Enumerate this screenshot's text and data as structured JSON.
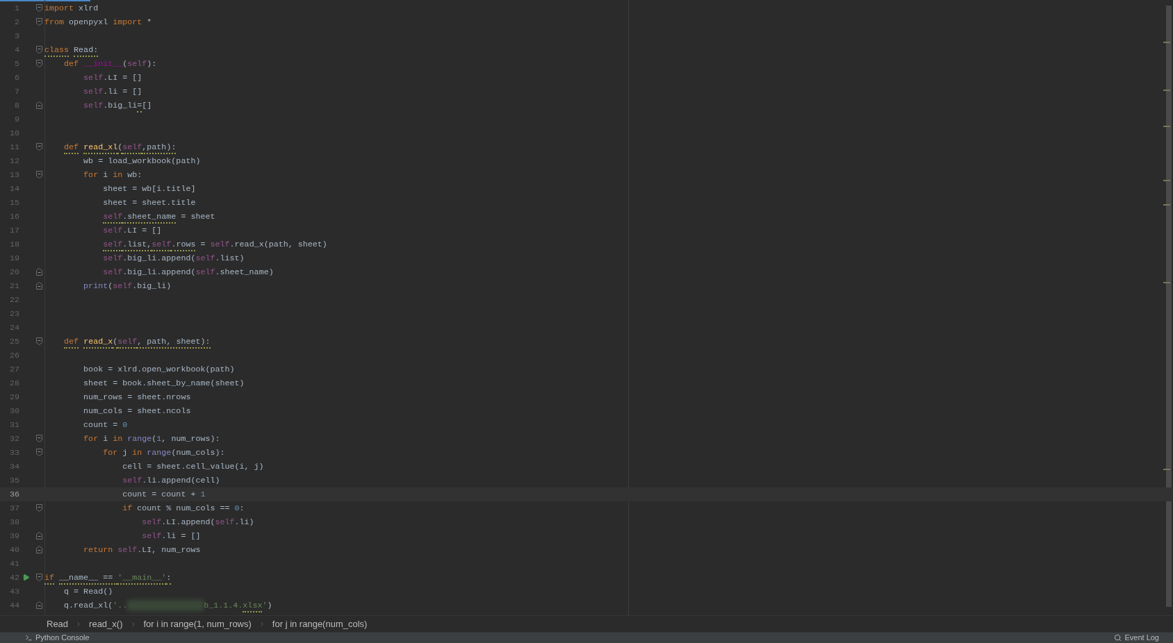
{
  "editor": {
    "lines": [
      {
        "number": "1",
        "fold_open": true,
        "fold_close": false,
        "run": false,
        "selected": false,
        "tokens": [
          {
            "text": "import",
            "kind": "keyword",
            "underlined": false
          },
          {
            "text": " xlrd",
            "kind": "plain",
            "underlined": false
          }
        ]
      },
      {
        "number": "2",
        "fold_open": true,
        "fold_close": false,
        "run": false,
        "selected": false,
        "tokens": [
          {
            "text": "from",
            "kind": "keyword",
            "underlined": false
          },
          {
            "text": " openpyxl ",
            "kind": "plain",
            "underlined": false
          },
          {
            "text": "import",
            "kind": "keyword",
            "underlined": false
          },
          {
            "text": " *",
            "kind": "plain",
            "underlined": false
          }
        ]
      },
      {
        "number": "3",
        "fold_open": false,
        "fold_close": false,
        "run": false,
        "selected": false
      },
      {
        "number": "4",
        "fold_open": true,
        "fold_close": false,
        "run": false,
        "selected": false,
        "tokens": [
          {
            "text": "class",
            "kind": "keyword",
            "underlined": true
          },
          {
            "text": " Read:",
            "kind": "plain",
            "underlined": true
          }
        ]
      },
      {
        "number": "5",
        "fold_open": true,
        "fold_close": false,
        "run": false,
        "selected": false,
        "tokens": [
          {
            "text": "    def",
            "kind": "keyword",
            "underlined": false
          },
          {
            "text": " __init__",
            "kind": "dunder",
            "underlined": false
          },
          {
            "text": "(",
            "kind": "plain",
            "underlined": false
          },
          {
            "text": "self",
            "kind": "self",
            "underlined": false
          },
          {
            "text": "):",
            "kind": "plain",
            "underlined": false
          }
        ]
      },
      {
        "number": "6",
        "fold_open": false,
        "fold_close": false,
        "run": false,
        "selected": false,
        "tokens": [
          {
            "text": "        self",
            "kind": "self",
            "underlined": false
          },
          {
            "text": ".LI = []",
            "kind": "plain",
            "underlined": false
          }
        ]
      },
      {
        "number": "7",
        "fold_open": false,
        "fold_close": false,
        "run": false,
        "selected": false,
        "tokens": [
          {
            "text": "        self",
            "kind": "self",
            "underlined": false
          },
          {
            "text": ".li = []",
            "kind": "plain",
            "underlined": false
          }
        ]
      },
      {
        "number": "8",
        "fold_open": false,
        "fold_close": true,
        "run": false,
        "selected": false,
        "tokens": [
          {
            "text": "        self",
            "kind": "self",
            "underlined": false
          },
          {
            "text": ".big_li",
            "kind": "plain",
            "underlined": false
          },
          {
            "text": "=",
            "kind": "plain",
            "underlined": true
          },
          {
            "text": "[]",
            "kind": "plain",
            "underlined": false
          }
        ]
      },
      {
        "number": "9",
        "fold_open": false,
        "fold_close": false,
        "run": false,
        "selected": false
      },
      {
        "number": "10",
        "fold_open": false,
        "fold_close": false,
        "run": false,
        "selected": false
      },
      {
        "number": "11",
        "fold_open": true,
        "fold_close": false,
        "run": false,
        "selected": false,
        "tokens": [
          {
            "text": "    def",
            "kind": "keyword",
            "underlined": true
          },
          {
            "text": " read_xl",
            "kind": "funcdef",
            "underlined": true
          },
          {
            "text": "(",
            "kind": "plain",
            "underlined": true
          },
          {
            "text": "self",
            "kind": "self",
            "underlined": true
          },
          {
            "text": ",path):",
            "kind": "plain",
            "underlined": true
          }
        ]
      },
      {
        "number": "12",
        "fold_open": false,
        "fold_close": false,
        "run": false,
        "selected": false,
        "tokens": [
          {
            "text": "        wb = load_workbook(path)",
            "kind": "plain",
            "underlined": false
          }
        ]
      },
      {
        "number": "13",
        "fold_open": true,
        "fold_close": false,
        "run": false,
        "selected": false,
        "tokens": [
          {
            "text": "        for",
            "kind": "keyword",
            "underlined": false
          },
          {
            "text": " i ",
            "kind": "plain",
            "underlined": false
          },
          {
            "text": "in",
            "kind": "keyword",
            "underlined": false
          },
          {
            "text": " wb:",
            "kind": "plain",
            "underlined": false
          }
        ]
      },
      {
        "number": "14",
        "fold_open": false,
        "fold_close": false,
        "run": false,
        "selected": false,
        "tokens": [
          {
            "text": "            sheet = wb[i.title]",
            "kind": "plain",
            "underlined": false
          }
        ]
      },
      {
        "number": "15",
        "fold_open": false,
        "fold_close": false,
        "run": false,
        "selected": false,
        "tokens": [
          {
            "text": "            sheet = sheet.title",
            "kind": "plain",
            "underlined": false
          }
        ]
      },
      {
        "number": "16",
        "fold_open": false,
        "fold_close": false,
        "run": false,
        "selected": false,
        "tokens": [
          {
            "text": "            self",
            "kind": "self",
            "underlined": true
          },
          {
            "text": ".sheet_name",
            "kind": "plain",
            "underlined": true
          },
          {
            "text": " = sheet",
            "kind": "plain",
            "underlined": false
          }
        ]
      },
      {
        "number": "17",
        "fold_open": false,
        "fold_close": false,
        "run": false,
        "selected": false,
        "tokens": [
          {
            "text": "            self",
            "kind": "self",
            "underlined": false
          },
          {
            "text": ".LI = []",
            "kind": "plain",
            "underlined": false
          }
        ]
      },
      {
        "number": "18",
        "fold_open": false,
        "fold_close": false,
        "run": false,
        "selected": false,
        "tokens": [
          {
            "text": "            self",
            "kind": "self",
            "underlined": true
          },
          {
            "text": ".list,",
            "kind": "plain",
            "underlined": true
          },
          {
            "text": "self",
            "kind": "self",
            "underlined": true
          },
          {
            "text": ".rows",
            "kind": "plain",
            "underlined": true
          },
          {
            "text": " = ",
            "kind": "plain",
            "underlined": false
          },
          {
            "text": "self",
            "kind": "self",
            "underlined": false
          },
          {
            "text": ".read_x(path, sheet)",
            "kind": "plain",
            "underlined": false
          }
        ]
      },
      {
        "number": "19",
        "fold_open": false,
        "fold_close": false,
        "run": false,
        "selected": false,
        "tokens": [
          {
            "text": "            self",
            "kind": "self",
            "underlined": false
          },
          {
            "text": ".big_li.append(",
            "kind": "plain",
            "underlined": false
          },
          {
            "text": "self",
            "kind": "self",
            "underlined": false
          },
          {
            "text": ".list)",
            "kind": "plain",
            "underlined": false
          }
        ]
      },
      {
        "number": "20",
        "fold_open": false,
        "fold_close": true,
        "run": false,
        "selected": false,
        "tokens": [
          {
            "text": "            self",
            "kind": "self",
            "underlined": false
          },
          {
            "text": ".big_li.append(",
            "kind": "plain",
            "underlined": false
          },
          {
            "text": "self",
            "kind": "self",
            "underlined": false
          },
          {
            "text": ".sheet_name)",
            "kind": "plain",
            "underlined": false
          }
        ]
      },
      {
        "number": "21",
        "fold_open": false,
        "fold_close": true,
        "run": false,
        "selected": false,
        "tokens": [
          {
            "text": "        print",
            "kind": "builtin",
            "underlined": false
          },
          {
            "text": "(",
            "kind": "plain",
            "underlined": false
          },
          {
            "text": "self",
            "kind": "self",
            "underlined": false
          },
          {
            "text": ".big_li)",
            "kind": "plain",
            "underlined": false
          }
        ]
      },
      {
        "number": "22",
        "fold_open": false,
        "fold_close": false,
        "run": false,
        "selected": false
      },
      {
        "number": "23",
        "fold_open": false,
        "fold_close": false,
        "run": false,
        "selected": false
      },
      {
        "number": "24",
        "fold_open": false,
        "fold_close": false,
        "run": false,
        "selected": false
      },
      {
        "number": "25",
        "fold_open": true,
        "fold_close": false,
        "run": false,
        "selected": false,
        "tokens": [
          {
            "text": "    def",
            "kind": "keyword",
            "underlined": true
          },
          {
            "text": " read_x",
            "kind": "funcdef",
            "underlined": true
          },
          {
            "text": "(",
            "kind": "plain",
            "underlined": true
          },
          {
            "text": "self",
            "kind": "self",
            "underlined": true
          },
          {
            "text": ", path, sheet):",
            "kind": "plain",
            "underlined": true
          }
        ]
      },
      {
        "number": "26",
        "fold_open": false,
        "fold_close": false,
        "run": false,
        "selected": false
      },
      {
        "number": "27",
        "fold_open": false,
        "fold_close": false,
        "run": false,
        "selected": false,
        "tokens": [
          {
            "text": "        book = xlrd.open_workbook(path)",
            "kind": "plain",
            "underlined": false
          }
        ]
      },
      {
        "number": "28",
        "fold_open": false,
        "fold_close": false,
        "run": false,
        "selected": false,
        "tokens": [
          {
            "text": "        sheet = book.sheet_by_name(sheet)",
            "kind": "plain",
            "underlined": false
          }
        ]
      },
      {
        "number": "29",
        "fold_open": false,
        "fold_close": false,
        "run": false,
        "selected": false,
        "tokens": [
          {
            "text": "        num_rows = sheet.nrows",
            "kind": "plain",
            "underlined": false
          }
        ]
      },
      {
        "number": "30",
        "fold_open": false,
        "fold_close": false,
        "run": false,
        "selected": false,
        "tokens": [
          {
            "text": "        num_cols = sheet.ncols",
            "kind": "plain",
            "underlined": false
          }
        ]
      },
      {
        "number": "31",
        "fold_open": false,
        "fold_close": false,
        "run": false,
        "selected": false,
        "tokens": [
          {
            "text": "        count = ",
            "kind": "plain",
            "underlined": false
          },
          {
            "text": "0",
            "kind": "number",
            "underlined": false
          }
        ]
      },
      {
        "number": "32",
        "fold_open": true,
        "fold_close": false,
        "run": false,
        "selected": false,
        "tokens": [
          {
            "text": "        for",
            "kind": "keyword",
            "underlined": false
          },
          {
            "text": " i ",
            "kind": "plain",
            "underlined": false
          },
          {
            "text": "in",
            "kind": "keyword",
            "underlined": false
          },
          {
            "text": " range",
            "kind": "builtin",
            "underlined": false
          },
          {
            "text": "(",
            "kind": "plain",
            "underlined": false
          },
          {
            "text": "1",
            "kind": "number",
            "underlined": false
          },
          {
            "text": ", num_rows):",
            "kind": "plain",
            "underlined": false
          }
        ]
      },
      {
        "number": "33",
        "fold_open": true,
        "fold_close": false,
        "run": false,
        "selected": false,
        "tokens": [
          {
            "text": "            for",
            "kind": "keyword",
            "underlined": false
          },
          {
            "text": " j ",
            "kind": "plain",
            "underlined": false
          },
          {
            "text": "in",
            "kind": "keyword",
            "underlined": false
          },
          {
            "text": " range",
            "kind": "builtin",
            "underlined": false
          },
          {
            "text": "(num_cols):",
            "kind": "plain",
            "underlined": false
          }
        ]
      },
      {
        "number": "34",
        "fold_open": false,
        "fold_close": false,
        "run": false,
        "selected": false,
        "tokens": [
          {
            "text": "                cell = sheet.cell_value(i, j)",
            "kind": "plain",
            "underlined": false
          }
        ]
      },
      {
        "number": "35",
        "fold_open": false,
        "fold_close": false,
        "run": false,
        "selected": false,
        "tokens": [
          {
            "text": "                self",
            "kind": "self",
            "underlined": false
          },
          {
            "text": ".li.append(cell)",
            "kind": "plain",
            "underlined": false
          }
        ]
      },
      {
        "number": "36",
        "fold_open": false,
        "fold_close": false,
        "run": false,
        "selected": true,
        "tokens": [
          {
            "text": "                count = count + ",
            "kind": "plain",
            "underlined": false
          },
          {
            "text": "1",
            "kind": "number",
            "underlined": false
          }
        ]
      },
      {
        "number": "37",
        "fold_open": true,
        "fold_close": false,
        "run": false,
        "selected": false,
        "tokens": [
          {
            "text": "                if",
            "kind": "keyword",
            "underlined": false
          },
          {
            "text": " count % num_cols == ",
            "kind": "plain",
            "underlined": false
          },
          {
            "text": "0",
            "kind": "number",
            "underlined": false
          },
          {
            "text": ":",
            "kind": "plain",
            "underlined": false
          }
        ]
      },
      {
        "number": "38",
        "fold_open": false,
        "fold_close": false,
        "run": false,
        "selected": false,
        "tokens": [
          {
            "text": "                    self",
            "kind": "self",
            "underlined": false
          },
          {
            "text": ".LI.append(",
            "kind": "plain",
            "underlined": false
          },
          {
            "text": "self",
            "kind": "self",
            "underlined": false
          },
          {
            "text": ".li)",
            "kind": "plain",
            "underlined": false
          }
        ]
      },
      {
        "number": "39",
        "fold_open": false,
        "fold_close": true,
        "run": false,
        "selected": false,
        "tokens": [
          {
            "text": "                    self",
            "kind": "self",
            "underlined": false
          },
          {
            "text": ".li = []",
            "kind": "plain",
            "underlined": false
          }
        ]
      },
      {
        "number": "40",
        "fold_open": false,
        "fold_close": true,
        "run": false,
        "selected": false,
        "tokens": [
          {
            "text": "        return",
            "kind": "keyword",
            "underlined": false
          },
          {
            "text": " self",
            "kind": "self",
            "underlined": false
          },
          {
            "text": ".LI, num_rows",
            "kind": "plain",
            "underlined": false
          }
        ]
      },
      {
        "number": "41",
        "fold_open": false,
        "fold_close": false,
        "run": false,
        "selected": false
      },
      {
        "number": "42",
        "fold_open": true,
        "fold_close": false,
        "run": true,
        "selected": false,
        "tokens": [
          {
            "text": "if",
            "kind": "keyword",
            "underlined": true
          },
          {
            "text": " __name__ == ",
            "kind": "plain",
            "underlined": true
          },
          {
            "text": "'__main__'",
            "kind": "string",
            "underlined": true
          },
          {
            "text": ":",
            "kind": "plain",
            "underlined": true
          }
        ]
      },
      {
        "number": "43",
        "fold_open": false,
        "fold_close": false,
        "run": false,
        "selected": false,
        "tokens": [
          {
            "text": "    q = Read()",
            "kind": "plain",
            "underlined": false
          }
        ]
      },
      {
        "number": "44",
        "fold_open": false,
        "fold_close": true,
        "run": false,
        "selected": false,
        "tokens": [
          {
            "text": "    q.read_xl(",
            "kind": "plain",
            "underlined": false
          },
          {
            "text": "'..",
            "kind": "string",
            "underlined": false
          },
          {
            "kind": "redacted"
          },
          {
            "text": "b_1.1.4.",
            "kind": "string",
            "underlined": false
          },
          {
            "text": "xlsx",
            "kind": "string",
            "underlined": true
          },
          {
            "text": "'",
            "kind": "string",
            "underlined": false
          },
          {
            "text": ")",
            "kind": "plain",
            "underlined": false
          }
        ]
      }
    ]
  },
  "breadcrumbs": [
    "Read",
    "read_x()",
    "for i in range(1, num_rows)",
    "for j in range(num_cols)"
  ],
  "tool_windows": [
    {
      "label": "Python Console",
      "kind": "console"
    },
    {
      "label": "Event Log",
      "kind": "log"
    }
  ]
}
